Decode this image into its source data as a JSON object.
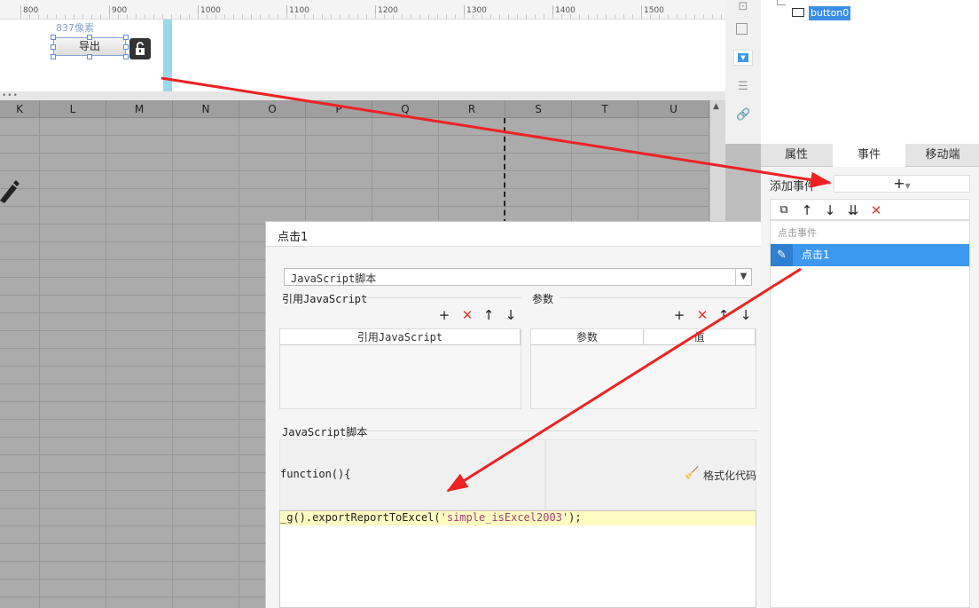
{
  "ruler": {
    "labels": [
      "800",
      "900",
      "1000",
      "1100",
      "1200",
      "1300",
      "1400",
      "1500"
    ]
  },
  "canvas": {
    "size_label": "837像素",
    "export_button": "导出",
    "lock_icon": "unlock-icon"
  },
  "grid": {
    "columns": [
      "K",
      "L",
      "M",
      "N",
      "O",
      "P",
      "Q",
      "R",
      "S",
      "T",
      "U"
    ]
  },
  "tree": {
    "item": "button0"
  },
  "tabs": [
    "属性",
    "事件",
    "移动端"
  ],
  "events": {
    "add_label": "添加事件",
    "add_icon": "+",
    "category": "点击事件",
    "item": "点击1"
  },
  "dialog": {
    "title": "点击1",
    "script_type": "JavaScript脚本",
    "ref_js_label": "引用JavaScript",
    "params_label": "参数",
    "ref_js_col": "引用JavaScript",
    "param_col": "参数",
    "value_col": "值",
    "js_section_label": "JavaScript脚本",
    "fn_header": "function(){",
    "format_button": "格式化代码",
    "code_prefix": "_g().exportReportToExcel(",
    "code_string": "'simple_isExcel2003'",
    "code_suffix": ");"
  },
  "colors": {
    "accent": "#3d98f0",
    "arrow": "#ee2222",
    "grid": "#ababab"
  }
}
